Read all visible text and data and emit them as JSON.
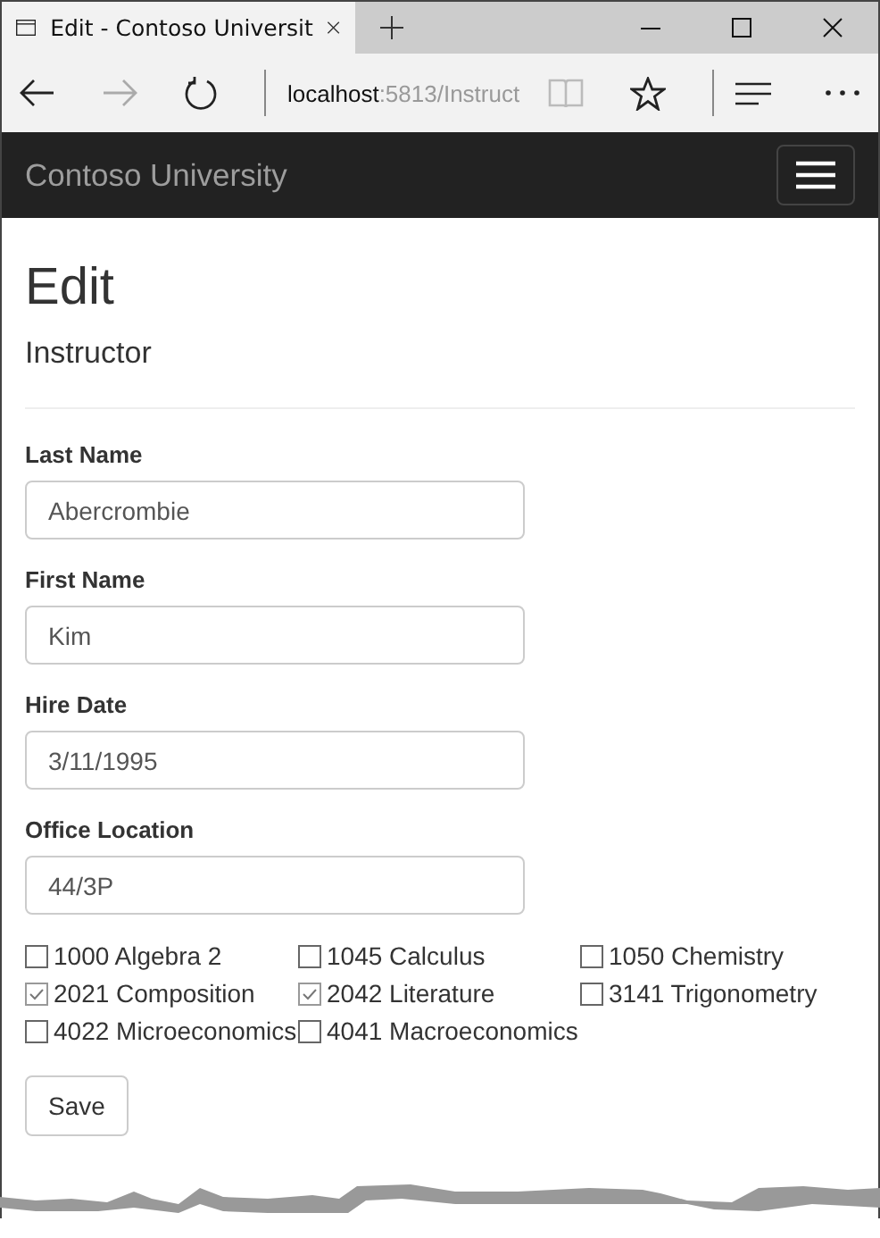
{
  "browser": {
    "tab_title": "Edit - Contoso Universit",
    "url_host": "localhost",
    "url_path": ":5813/Instruct"
  },
  "navbar": {
    "brand": "Contoso University"
  },
  "page": {
    "heading": "Edit",
    "subheading": "Instructor"
  },
  "fields": [
    {
      "label": "Last Name",
      "value": "Abercrombie"
    },
    {
      "label": "First Name",
      "value": "Kim"
    },
    {
      "label": "Hire Date",
      "value": "3/11/1995"
    },
    {
      "label": "Office Location",
      "value": "44/3P"
    }
  ],
  "courses": [
    {
      "label": "1000 Algebra 2",
      "checked": false
    },
    {
      "label": "1045 Calculus",
      "checked": false
    },
    {
      "label": "1050 Chemistry",
      "checked": false
    },
    {
      "label": "2021 Composition",
      "checked": true
    },
    {
      "label": "2042 Literature",
      "checked": true
    },
    {
      "label": "3141 Trigonometry",
      "checked": false
    },
    {
      "label": "4022 Microeconomics",
      "checked": false
    },
    {
      "label": "4041 Macroeconomics",
      "checked": false
    }
  ],
  "save_button": "Save"
}
